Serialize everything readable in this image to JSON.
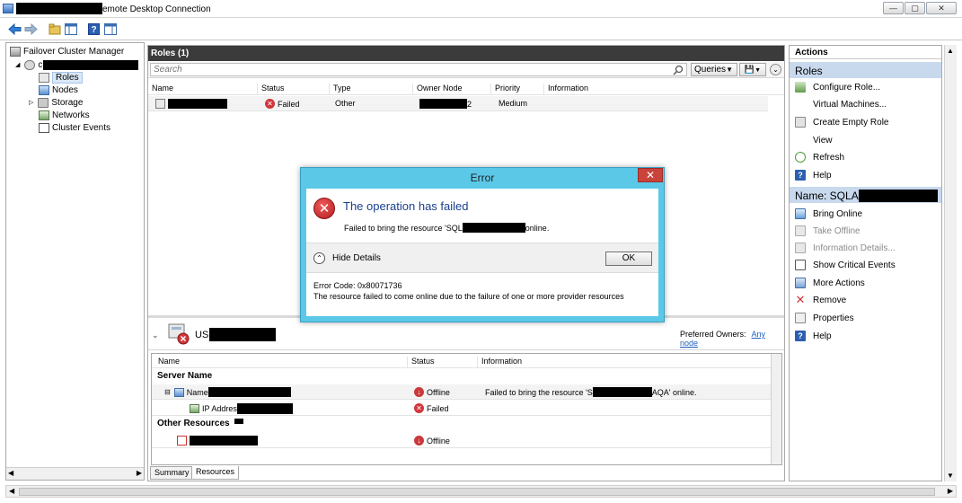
{
  "window": {
    "title_suffix": "emote Desktop Connection",
    "min_glyph": "—",
    "max_glyph": "▢",
    "close_glyph": "✕"
  },
  "nav": {
    "root": "Failover Cluster Manager",
    "cluster_prefix": "c",
    "items": [
      {
        "label": "Roles"
      },
      {
        "label": "Nodes"
      },
      {
        "label": "Storage"
      },
      {
        "label": "Networks"
      },
      {
        "label": "Cluster Events"
      }
    ]
  },
  "roles": {
    "header": "Roles (1)",
    "search_placeholder": "Search",
    "queries_label": "Queries",
    "columns": [
      "Name",
      "Status",
      "Type",
      "Owner Node",
      "Priority",
      "Information"
    ],
    "rows": [
      {
        "status": "Failed",
        "type": "Other",
        "owner_suffix": "2",
        "priority": "Medium",
        "information": ""
      }
    ]
  },
  "detail": {
    "name_prefix": "US",
    "preferred_owners_label": "Preferred Owners:",
    "preferred_owners_link": "Any node",
    "columns": [
      "Name",
      "Status",
      "Information"
    ],
    "groups": {
      "server": "Server Name",
      "other": "Other Resources"
    },
    "rows": [
      {
        "name": "Name",
        "status": "Offline",
        "information_prefix": "Failed to bring the resource 'S",
        "information_suffix": "AQA' online."
      },
      {
        "name": "IP Addres",
        "status": "Failed",
        "information_prefix": "",
        "information_suffix": ""
      },
      {
        "name": "",
        "status": "Offline",
        "information_prefix": "",
        "information_suffix": ""
      }
    ],
    "tabs": [
      "Summary",
      "Resources"
    ]
  },
  "actions": {
    "title": "Actions",
    "roles_section": "Roles",
    "roles_items": [
      "Configure Role...",
      "Virtual Machines...",
      "Create Empty Role",
      "View",
      "Refresh",
      "Help"
    ],
    "name_section_prefix": "Name: SQLA",
    "name_items": [
      {
        "label": "Bring Online",
        "disabled": false
      },
      {
        "label": "Take Offline",
        "disabled": true
      },
      {
        "label": "Information Details...",
        "disabled": true
      },
      {
        "label": "Show Critical Events",
        "disabled": false
      },
      {
        "label": "More Actions",
        "disabled": false
      },
      {
        "label": "Remove",
        "disabled": false
      },
      {
        "label": "Properties",
        "disabled": false
      },
      {
        "label": "Help",
        "disabled": false
      }
    ]
  },
  "dialog": {
    "title": "Error",
    "heading": "The operation has failed",
    "message_prefix": "Failed to bring the resource 'SQL",
    "message_suffix": " online.",
    "hide_details": "Hide Details",
    "ok_label": "OK",
    "error_code": "Error Code: 0x80071736",
    "error_detail": "The resource failed to come online due to the failure of one or more provider resources"
  },
  "colors": {
    "accent_blue": "#1a3f8f",
    "dialog_frame": "#5bc8e8",
    "section_bg": "#c8d9ee",
    "failed_red": "#d0363b"
  }
}
